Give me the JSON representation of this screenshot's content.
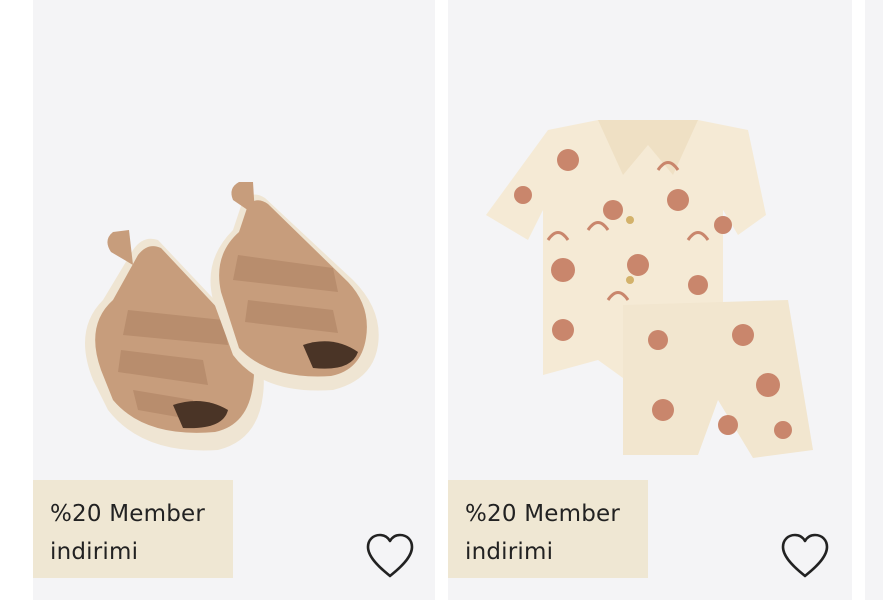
{
  "products": [
    {
      "image": "sandals-image",
      "badge_line1": "%20 Member",
      "badge_line2": "indirimi",
      "favorite_icon": "heart-outline-icon"
    },
    {
      "image": "pajama-set-image",
      "badge_line1": "%20 Member",
      "badge_line2": "indirimi",
      "favorite_icon": "heart-outline-icon"
    }
  ],
  "colors": {
    "card_bg": "#f4f4f6",
    "badge_bg": "#efe7d3",
    "text": "#222222"
  }
}
